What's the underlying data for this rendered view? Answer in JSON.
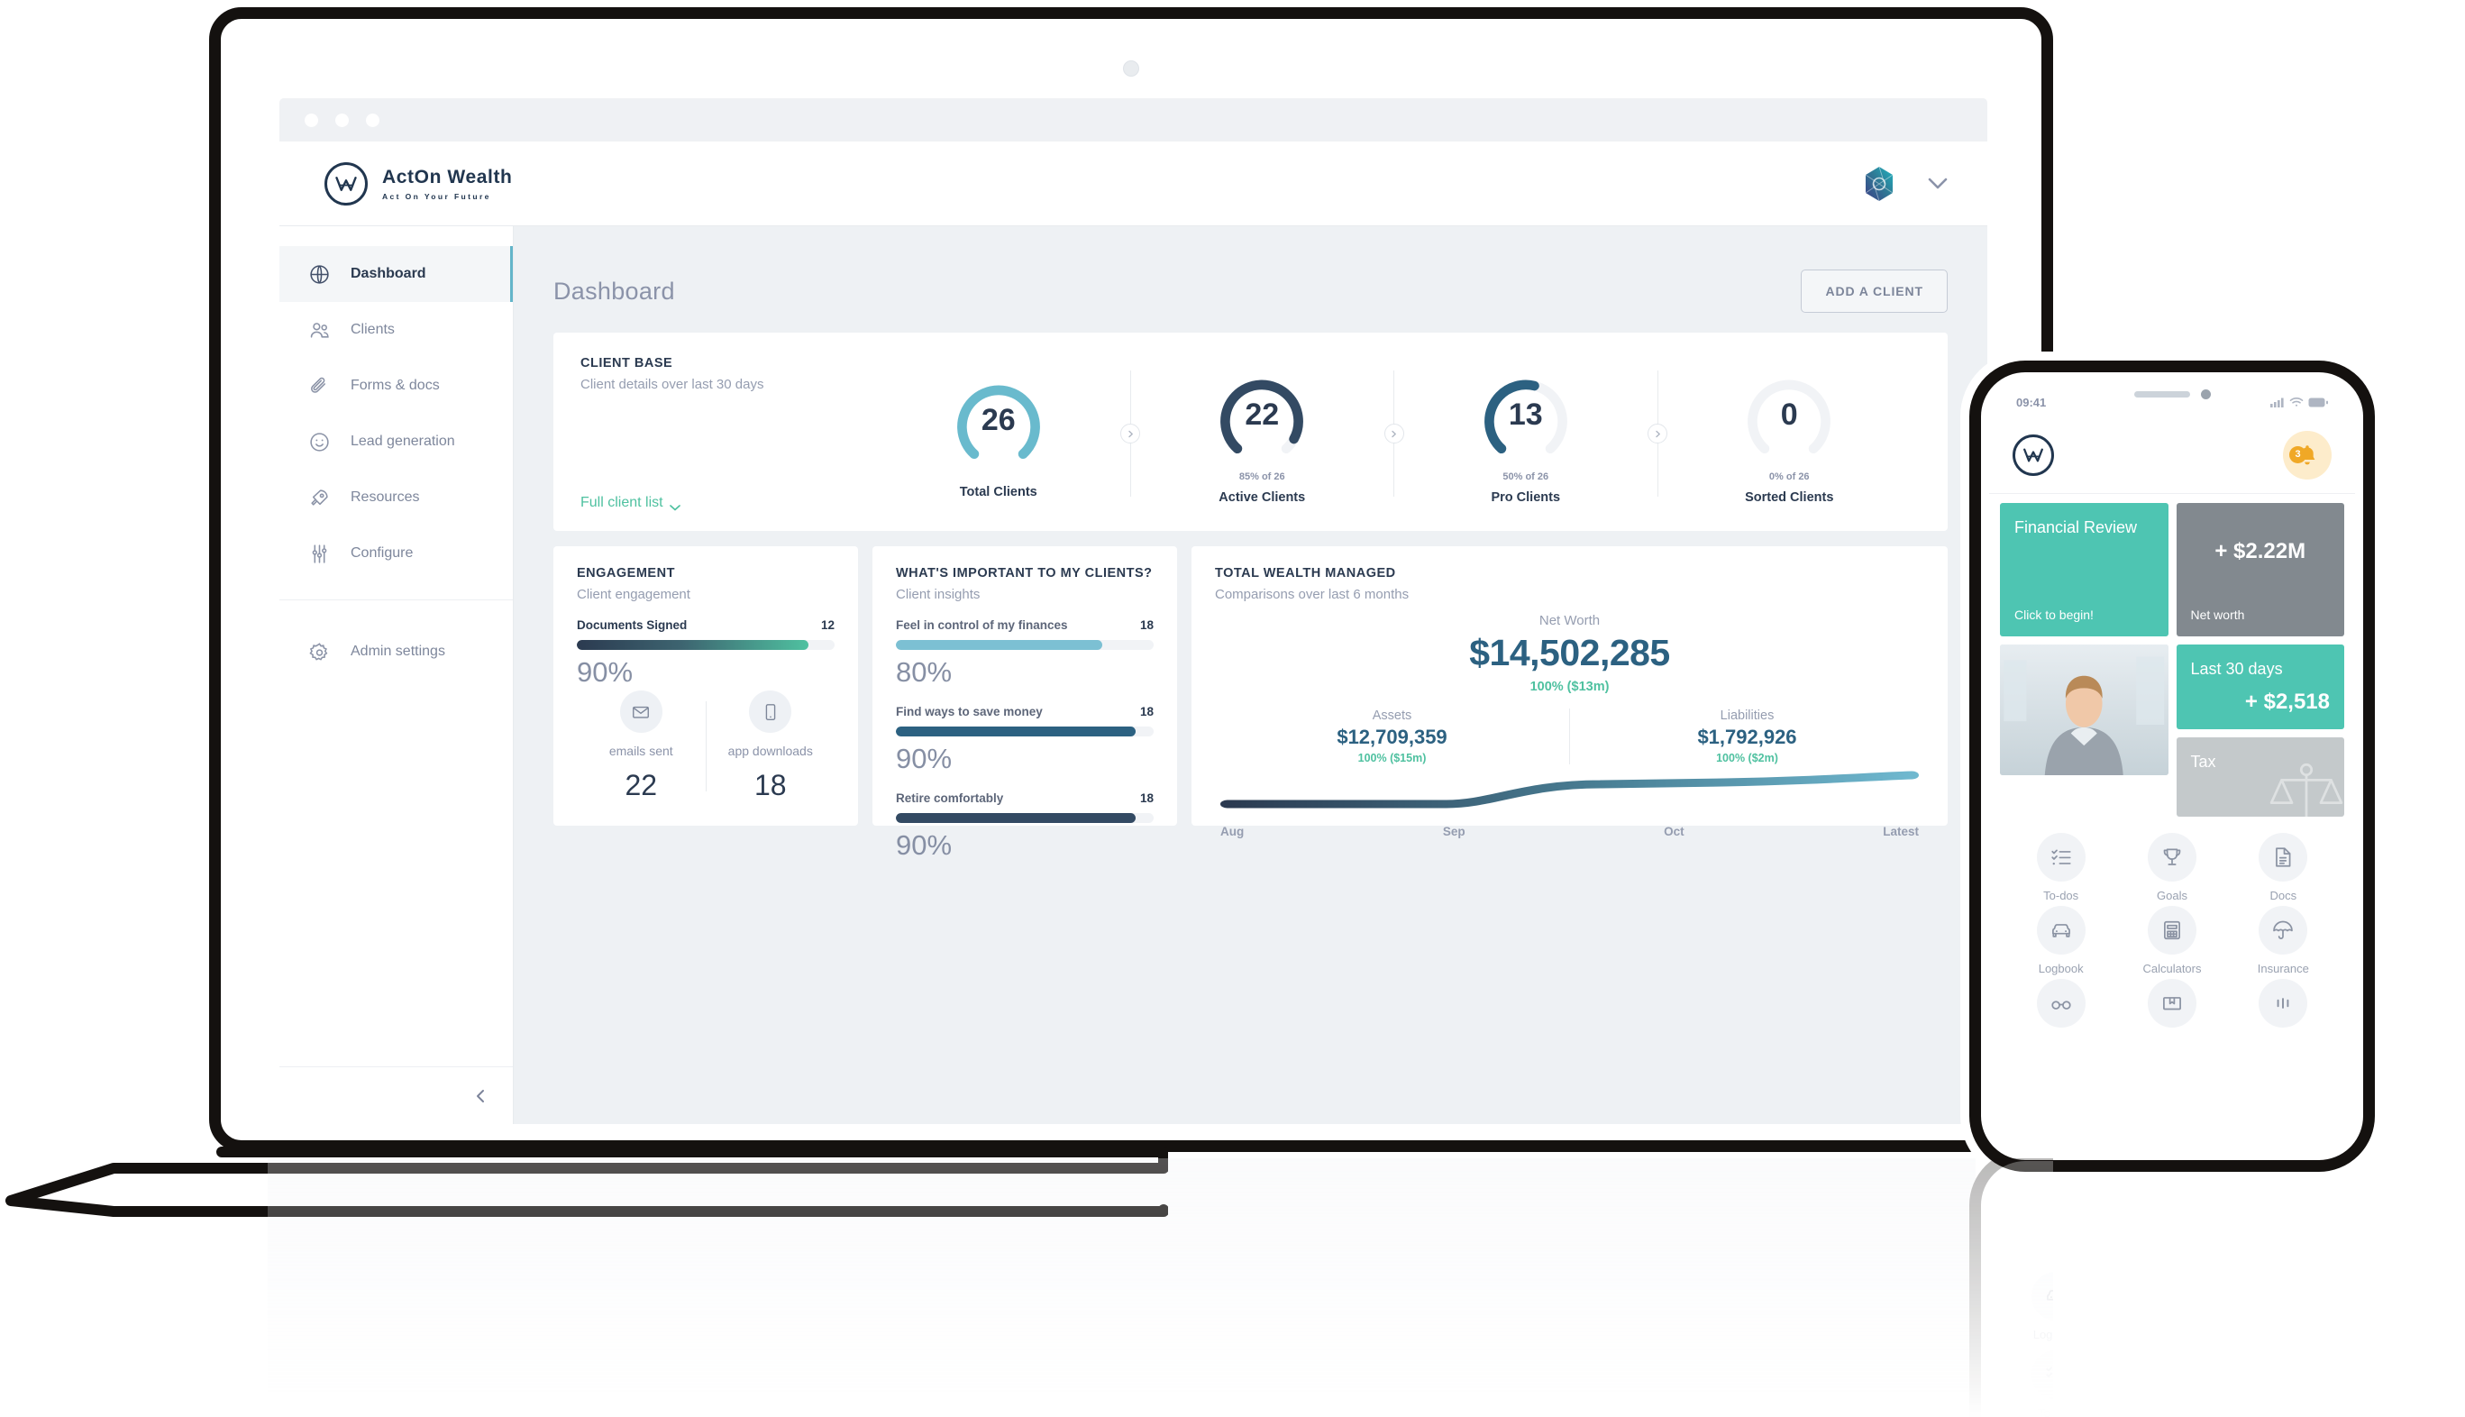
{
  "brand": {
    "initials": "W",
    "name": "ActOn Wealth",
    "tagline": "Act On Your Future"
  },
  "browser": {
    "dots": [
      "",
      "",
      ""
    ]
  },
  "header": {
    "app_switcher_icon": "app-switcher-icon",
    "chevron_icon": "chevron-down-icon"
  },
  "sidebar": {
    "items": [
      {
        "label": "Dashboard",
        "icon": "globe-icon",
        "active": true
      },
      {
        "label": "Clients",
        "icon": "users-icon",
        "active": false
      },
      {
        "label": "Forms & docs",
        "icon": "paperclip-icon",
        "active": false
      },
      {
        "label": "Lead generation",
        "icon": "smiley-icon",
        "active": false
      },
      {
        "label": "Resources",
        "icon": "rocket-icon",
        "active": false
      },
      {
        "label": "Configure",
        "icon": "sliders-icon",
        "active": false
      }
    ],
    "admin": {
      "label": "Admin settings",
      "icon": "gear-icon"
    },
    "collapse_icon": "chevron-left-icon"
  },
  "main": {
    "page_title": "Dashboard",
    "add_client_label": "ADD A CLIENT"
  },
  "client_base": {
    "kicker": "CLIENT BASE",
    "subtitle": "Client details over last 30 days",
    "full_list_label": "Full client list",
    "full_list_chevron": "chevron-down-icon",
    "donuts": [
      {
        "value": "26",
        "pct_text": "",
        "label": "Total Clients",
        "percent": 85,
        "color": "#69bacd",
        "track": "#ffffff"
      },
      {
        "value": "22",
        "pct_text": "85% of 26",
        "label": "Active Clients",
        "percent": 85,
        "color": "#334a63",
        "track": "#f1f3f6"
      },
      {
        "value": "13",
        "pct_text": "50% of 26",
        "label": "Pro Clients",
        "percent": 50,
        "color": "#2c6181",
        "track": "#f1f3f6"
      },
      {
        "value": "0",
        "pct_text": "0% of 26",
        "label": "Sorted Clients",
        "percent": 0,
        "color": "#f1f3f6",
        "track": "#f1f3f6"
      }
    ]
  },
  "engagement": {
    "kicker": "ENGAGEMENT",
    "subtitle": "Client engagement",
    "bar": {
      "name": "Documents Signed",
      "count": "12",
      "percent_text": "90%",
      "percent": 90
    },
    "stats": [
      {
        "icon": "envelope-icon",
        "label": "emails sent",
        "value": "22"
      },
      {
        "icon": "mobile-icon",
        "label": "app downloads",
        "value": "18"
      }
    ]
  },
  "insights": {
    "kicker": "WHAT'S IMPORTANT TO MY CLIENTS?",
    "subtitle": "Client insights",
    "bars": [
      {
        "name": "Feel in control of my finances",
        "count": "18",
        "percent_text": "80%",
        "percent": 80,
        "color": "#7cc0d3"
      },
      {
        "name": "Find ways to save money",
        "count": "18",
        "percent_text": "90%",
        "percent": 90,
        "color": "#2c6181"
      },
      {
        "name": "Retire comfortably",
        "count": "18",
        "percent_text": "90%",
        "percent": 90,
        "color": "#334a63"
      }
    ]
  },
  "wealth": {
    "kicker": "TOTAL WEALTH MANAGED",
    "subtitle": "Comparisons over last 6 months",
    "net_worth_label": "Net Worth",
    "net_worth_value": "$14,502,285",
    "net_worth_delta": "100% ($13m)",
    "assets_label": "Assets",
    "assets_value": "$12,709,359",
    "assets_delta": "100% ($15m)",
    "liabilities_label": "Liabilities",
    "liabilities_value": "$1,792,926",
    "liabilities_delta": "100% ($2m)",
    "chart_data": {
      "type": "line",
      "title": "Total wealth managed",
      "categories": [
        "Aug",
        "Sep",
        "Oct",
        "Latest"
      ],
      "series": [
        {
          "name": "Net worth",
          "values": [
            12.3,
            12.3,
            13.9,
            14.5
          ]
        }
      ],
      "ylabel": "Net worth ($m)",
      "xlabel": "",
      "ylim": [
        11.5,
        15.0
      ],
      "grid": false,
      "legend": "none",
      "line_gradient": [
        "#2b3a50",
        "#6fb8cf"
      ]
    }
  },
  "phone": {
    "status_time": "09:41",
    "signal_icon": "cellular-icon",
    "wifi_icon": "wifi-icon",
    "battery_icon": "battery-icon",
    "logo_initials": "W",
    "bell_icon": "bell-icon",
    "bell_count": "3",
    "tiles": [
      {
        "title": "Financial Review",
        "sub": "Click to begin!",
        "style": "teal"
      },
      {
        "title": "",
        "big": "+ $2.22M",
        "sub": "Net worth",
        "style": "gray"
      },
      {
        "title": "",
        "style": "photo",
        "name": "advisor-photo"
      },
      {
        "title": "Last 30 days",
        "big": "+ $2,518",
        "style": "teal"
      },
      {
        "title": "Tax",
        "style": "lgray",
        "icon": "scales-icon"
      }
    ],
    "grid": [
      {
        "label": "To-dos",
        "icon": "checklist-icon"
      },
      {
        "label": "Goals",
        "icon": "trophy-icon"
      },
      {
        "label": "Docs",
        "icon": "document-icon"
      },
      {
        "label": "Logbook",
        "icon": "car-icon"
      },
      {
        "label": "Calculators",
        "icon": "calculator-icon"
      },
      {
        "label": "Insurance",
        "icon": "umbrella-icon"
      }
    ],
    "grid_row3": [
      {
        "label": "",
        "icon": "glasses-icon"
      },
      {
        "label": "",
        "icon": "book-icon"
      },
      {
        "label": "",
        "icon": "more-icon"
      }
    ]
  },
  "colors": {
    "accent_teal": "#4fc1a0",
    "accent_blue": "#2c6181",
    "navy": "#2b3a50",
    "light_blue": "#69bacd",
    "amber": "#f0a826"
  }
}
